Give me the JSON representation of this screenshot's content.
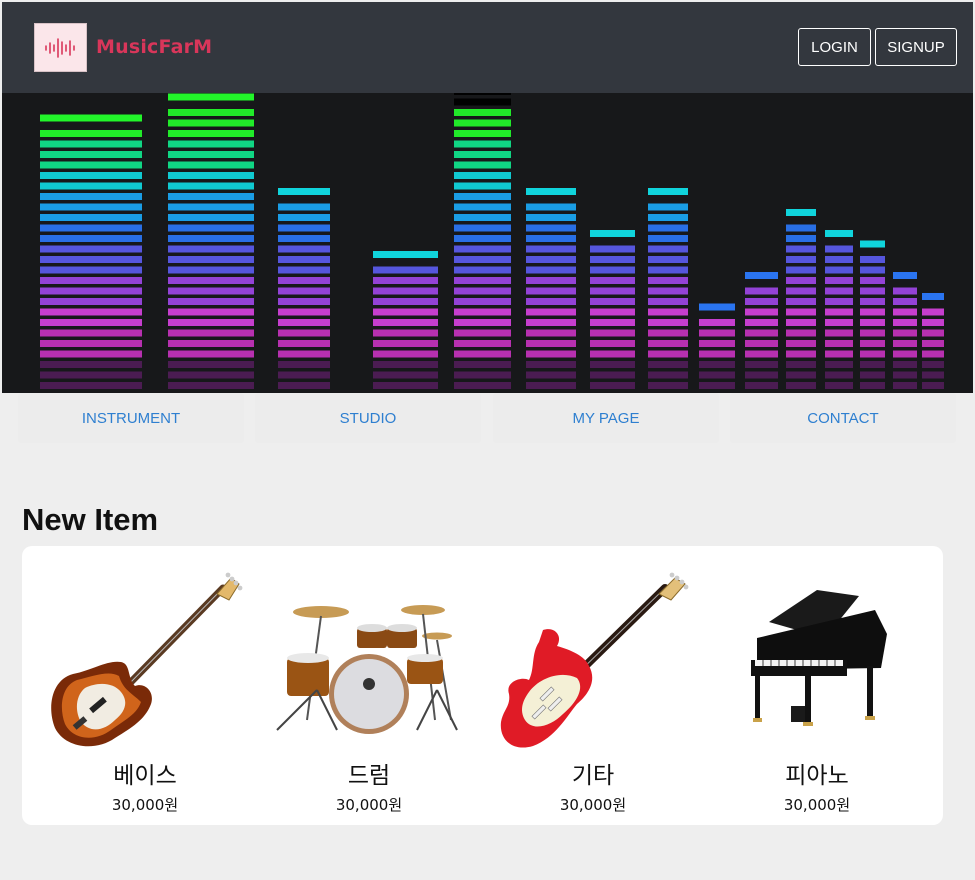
{
  "brand": {
    "name": "MusicFarM",
    "logo_icon": "sound-wave-icon",
    "accent": "#d9365a"
  },
  "header": {
    "login_label": "LOGIN",
    "signup_label": "SIGNUP",
    "background": "#33373e"
  },
  "hero": {
    "image": "equalizer-bars-image"
  },
  "nav": {
    "items": [
      {
        "label": "INSTRUMENT"
      },
      {
        "label": "STUDIO"
      },
      {
        "label": "MY PAGE"
      },
      {
        "label": "CONTACT"
      }
    ],
    "link_color": "#2e7fd0"
  },
  "section": {
    "title": "New Item"
  },
  "products": [
    {
      "name": "베이스",
      "price": "30,000원",
      "image": "bass-guitar-image"
    },
    {
      "name": "드럼",
      "price": "30,000원",
      "image": "drum-kit-image"
    },
    {
      "name": "기타",
      "price": "30,000원",
      "image": "electric-guitar-image"
    },
    {
      "name": "피아노",
      "price": "30,000원",
      "image": "grand-piano-image"
    }
  ]
}
